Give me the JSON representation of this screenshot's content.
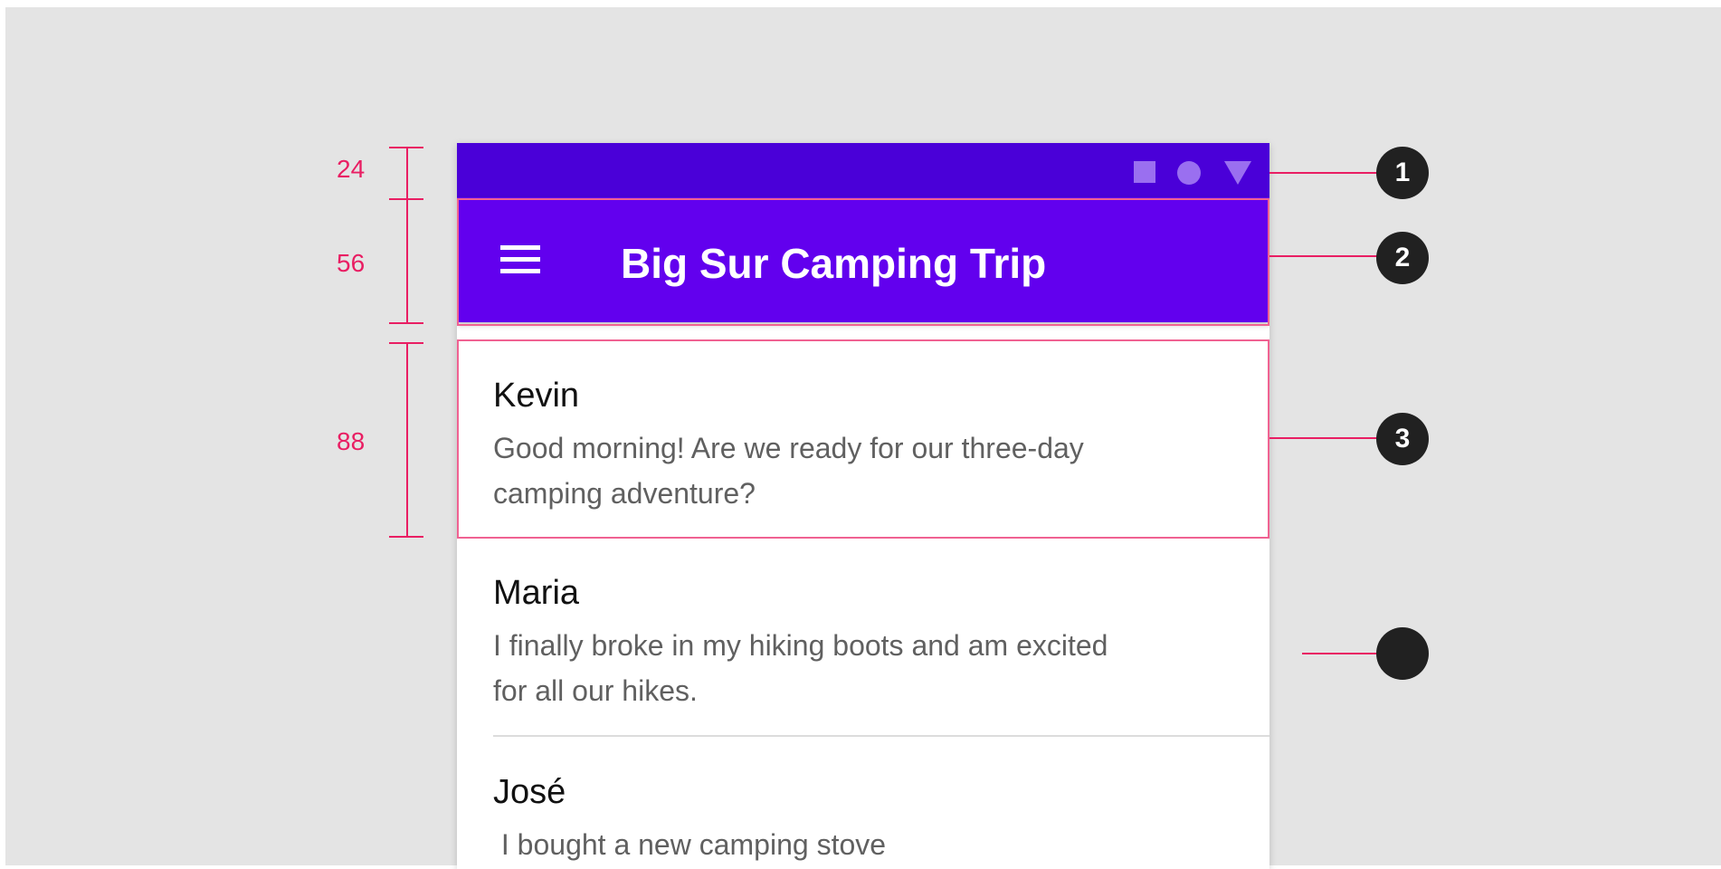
{
  "app_bar": {
    "title": "Big Sur Camping Trip"
  },
  "messages": [
    {
      "name": "Kevin",
      "text": "Good morning! Are we ready for our three-day camping adventure?"
    },
    {
      "name": "Maria",
      "text": "I finally broke in my hiking boots and am excited for all our hikes."
    },
    {
      "name": "José",
      "text": " I bought a new camping stove"
    }
  ],
  "dimensions": {
    "status_bar": "24",
    "app_bar": "56",
    "list_item": "88"
  },
  "callouts": [
    "1",
    "2",
    "3",
    ""
  ],
  "colors": {
    "status_bar": "#4a00d8",
    "app_bar": "#6200ee",
    "highlight": "#f06292",
    "dimension": "#e91e63",
    "callout": "#212121"
  }
}
